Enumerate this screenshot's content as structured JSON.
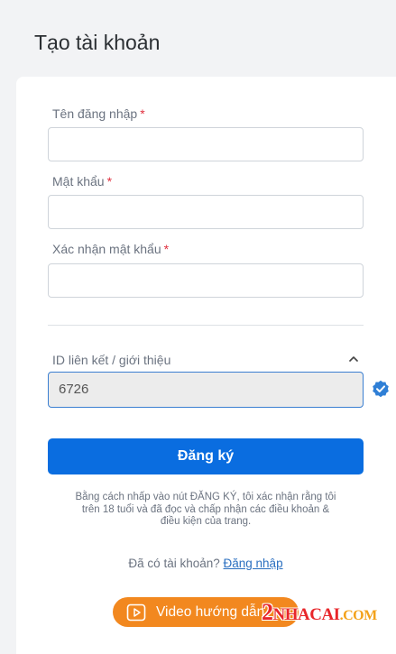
{
  "page": {
    "title": "Tạo tài khoản"
  },
  "form": {
    "username": {
      "label": "Tên đăng nhập",
      "required_mark": "*",
      "value": ""
    },
    "password": {
      "label": "Mật khẩu",
      "required_mark": "*",
      "value": ""
    },
    "confirm_password": {
      "label": "Xác nhận mật khẩu",
      "required_mark": "*",
      "value": ""
    },
    "referral": {
      "label": "ID liên kết / giới thiệu",
      "value": "6726",
      "expanded": true,
      "verified": true
    },
    "register_button": "Đăng ký",
    "terms_text": "Bằng cách nhấp vào nút ĐĂNG KÝ, tôi xác nhận rằng tôi trên 18 tuổi và đã đọc và chấp nhận các điều khoản & điều kiện của trang.",
    "login_prompt": "Đã có tài khoản?",
    "login_link": "Đăng nhập"
  },
  "video_button": {
    "label": "Video hướng dẫn",
    "icon": "play-video-icon"
  },
  "watermark": {
    "digit": "2",
    "main": "NHACAI",
    "suffix": ".COM"
  },
  "colors": {
    "primary": "#0a6de0",
    "required": "#e0303f",
    "video_button": "#f2881f",
    "link": "#2a6fc0",
    "verified": "#2f7fd6"
  }
}
